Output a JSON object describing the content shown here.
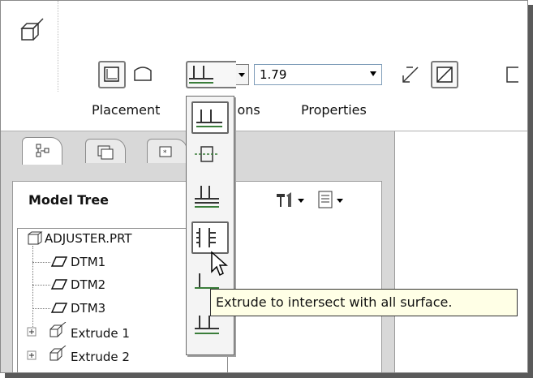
{
  "toolbar": {
    "depth_value": "1.79",
    "tabs": [
      "Placement",
      "Options",
      "Properties"
    ]
  },
  "panel": {
    "title": "Model Tree"
  },
  "tree": {
    "items": [
      {
        "label": "ADJUSTER.PRT",
        "icon": "part-icon"
      },
      {
        "label": "DTM1",
        "icon": "datum-plane-icon"
      },
      {
        "label": "DTM2",
        "icon": "datum-plane-icon"
      },
      {
        "label": "DTM3",
        "icon": "datum-plane-icon"
      },
      {
        "label": "Extrude 1",
        "icon": "extrude-icon"
      },
      {
        "label": "Extrude 2",
        "icon": "extrude-icon"
      }
    ]
  },
  "depth_menu": {
    "options": [
      "blind-depth-icon",
      "symmetric-depth-icon",
      "through-next-icon",
      "through-all-icon",
      "to-selected-icon",
      "to-surface-icon"
    ]
  },
  "tooltip": {
    "text": "Extrude to intersect with all surface."
  },
  "colors": {
    "panel_bg": "#d8d8d8",
    "tooltip_bg": "#ffffe6",
    "field_border": "#7f9db9"
  }
}
